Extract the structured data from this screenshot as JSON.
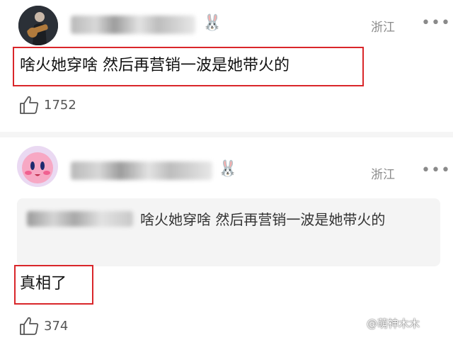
{
  "comments": [
    {
      "badge": "🐰",
      "location": "浙江",
      "more": "•••",
      "text": "啥火她穿啥 然后再营销一波是她带火的",
      "likes": "1752"
    },
    {
      "badge": "🐰",
      "location": "浙江",
      "more": "•••",
      "quote_text": "啥火她穿啥 然后再营销一波是她带火的",
      "text": "真相了",
      "likes": "374"
    }
  ],
  "watermark": "@萌神木木",
  "colors": {
    "highlight_box": "#d9262a",
    "meta_text": "#8a8a8a",
    "quote_bg": "#f4f4f4"
  }
}
